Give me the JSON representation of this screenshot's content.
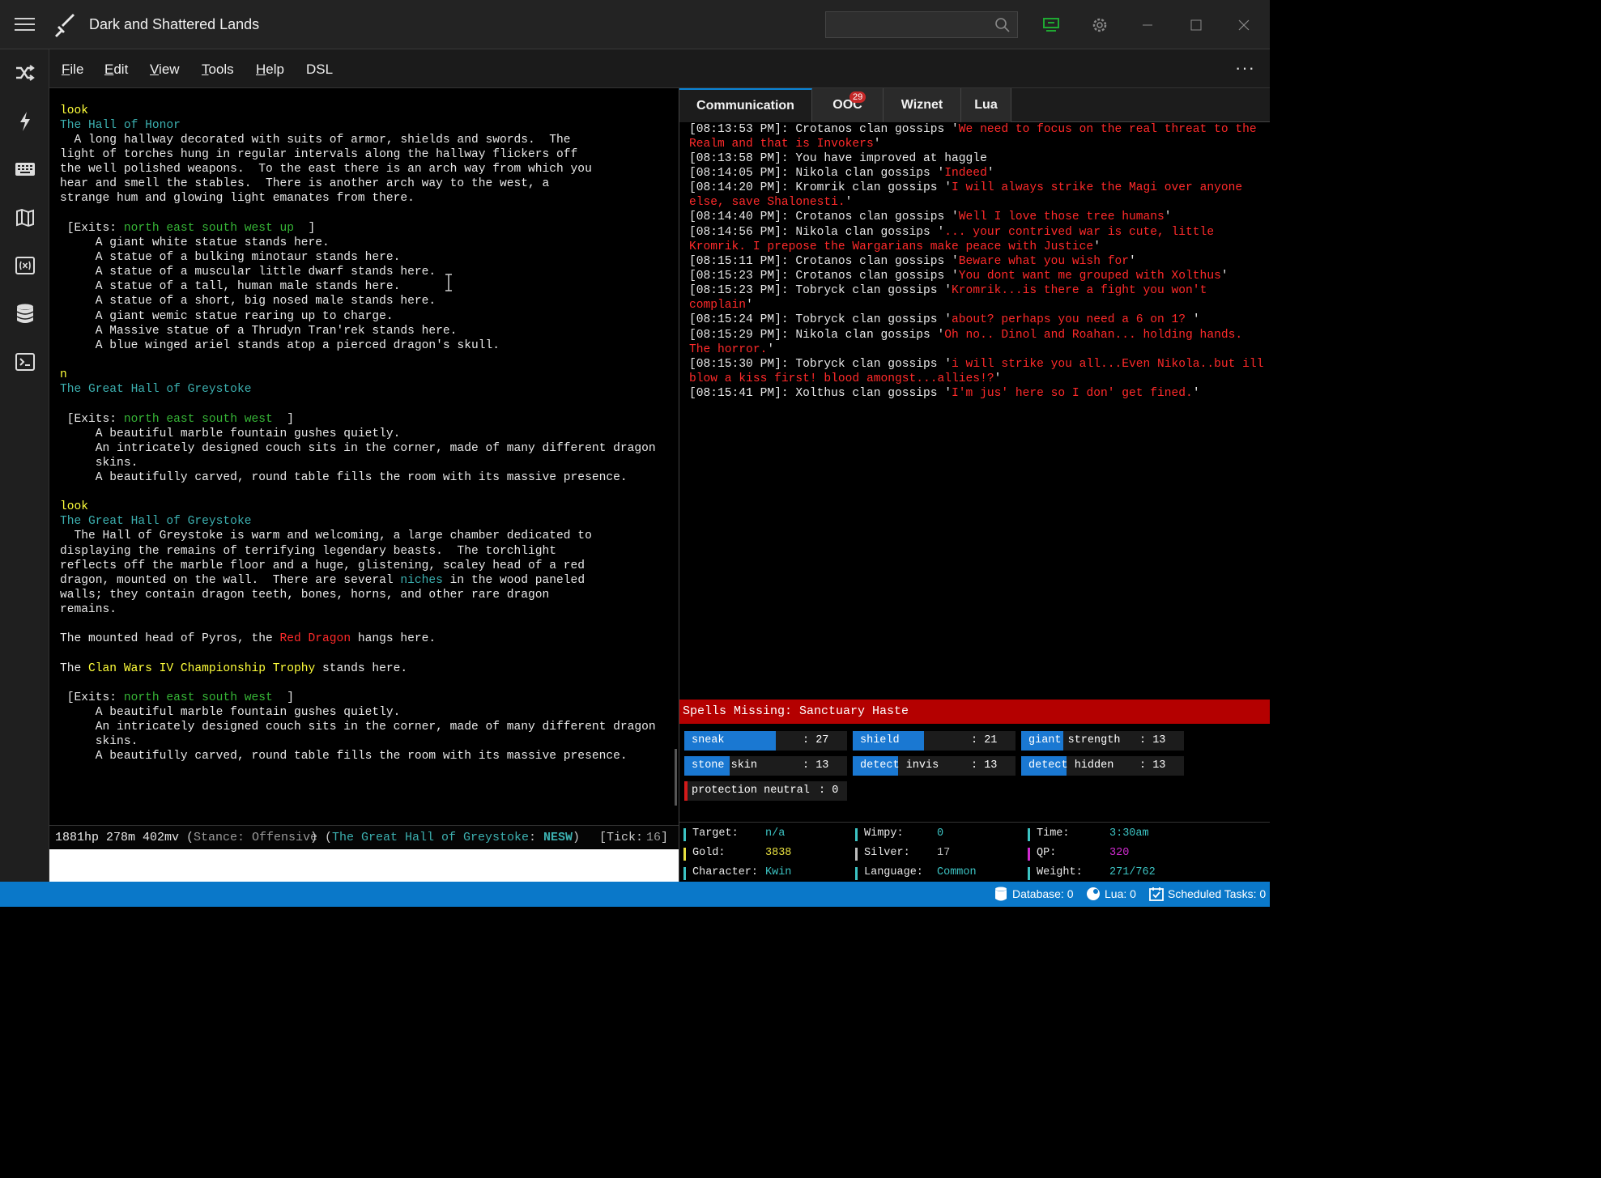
{
  "app": {
    "title": "Dark and Shattered Lands"
  },
  "menu": {
    "file": "F",
    "file_rest": "ile",
    "edit": "E",
    "edit_rest": "dit",
    "view": "V",
    "view_rest": "iew",
    "tools": "T",
    "tools_rest": "ools",
    "help": "H",
    "help_rest": "elp",
    "dsl": "DSL"
  },
  "terminal": {
    "l1": "look",
    "l2": "The Hall of Honor",
    "l3": "  A long hallway decorated with suits of armor, shields and swords.  The",
    "l4": "light of torches hung in regular intervals along the hallway flickers off",
    "l5": "the well polished weapons.  To the east there is an arch way from which you",
    "l6": "hear and smell the stables.  There is another arch way to the west, a",
    "l7": "strange hum and glowing light emanates from there.",
    "l9a": " [Exits: ",
    "l9b": "north east south west up",
    "l9c": "  ]",
    "l10": "     A giant white statue stands here.",
    "l11": "     A statue of a bulking minotaur stands here.",
    "l12": "     A statue of a muscular little dwarf stands here.",
    "l13": "     A statue of a tall, human male stands here.",
    "l14": "     A statue of a short, big nosed male stands here.",
    "l15": "     A giant wemic statue rearing up to charge.",
    "l16": "     A Massive statue of a Thrudyn Tran'rek stands here.",
    "l17": "     A blue winged ariel stands atop a pierced dragon's skull.",
    "l19": "n",
    "l20": "The Great Hall of Greystoke",
    "l22a": " [Exits: ",
    "l22b": "north east south west",
    "l22c": "  ]",
    "l23": "     A beautiful marble fountain gushes quietly.",
    "l24": "     An intricately designed couch sits in the corner, made of many different dragon",
    "l25": "     skins.",
    "l26": "     A beautifully carved, round table fills the room with its massive presence.",
    "l28": "look",
    "l29": "The Great Hall of Greystoke",
    "l30": "  The Hall of Greystoke is warm and welcoming, a large chamber dedicated to",
    "l31": "displaying the remains of terrifying legendary beasts.  The torchlight",
    "l32": "reflects off the marble floor and a huge, glistening, scaley head of a red",
    "l33a": "dragon, mounted on the wall.  There are several ",
    "l33b": "niches",
    "l33c": " in the wood paneled",
    "l34": "walls; they contain dragon teeth, bones, horns, and other rare dragon",
    "l35": "remains.",
    "l37a": "The mounted head of Pyros, the ",
    "l37b": "Red Dragon",
    "l37c": " hangs here.",
    "l39a": "The ",
    "l39b": "Clan Wars IV Championship Trophy",
    "l39c": " stands here.",
    "l41a": " [Exits: ",
    "l41b": "north east south west",
    "l41c": "  ]",
    "l42": "     A beautiful marble fountain gushes quietly.",
    "l43": "     An intricately designed couch sits in the corner, made of many different dragon",
    "l44": "     skins.",
    "l45": "     A beautifully carved, round table fills the room with its massive presence."
  },
  "prompt": {
    "hp": "1881hp 278m 402mv",
    "stance_open": " (",
    "stance_lbl": "Stance:",
    "stance_val": "Offensive",
    "stance_close": ")",
    "room_open": " (",
    "room": "The Great Hall of Greystoke",
    "colon": ":",
    "dirs": " NESW",
    "room_close": ")",
    "tick_open": "[",
    "tick_lbl": "Tick:",
    "tick_val": "16",
    "tick_close": "]"
  },
  "tabs": {
    "communication": "Communication",
    "ooc": "OOC",
    "ooc_badge": "29",
    "wiznet": "Wiznet",
    "lua": "Lua"
  },
  "comm": [
    {
      "p": "[08:13:53 PM]: Crotanos clan gossips '",
      "q": "We need to focus on the real threat to the"
    },
    {
      "p": "",
      "q": "Realm and that is Invokers",
      "s": "'"
    },
    {
      "p": "[08:13:58 PM]: You have improved at haggle",
      "q": ""
    },
    {
      "p": "[08:14:05 PM]: Nikola clan gossips '",
      "q": "Indeed",
      "s": "'"
    },
    {
      "p": "[08:14:20 PM]: Kromrik clan gossips '",
      "q": "I will always strike the Magi over anyone"
    },
    {
      "p": "",
      "q": "else, save Shalonesti.",
      "s": "'"
    },
    {
      "p": "[08:14:40 PM]: Crotanos clan gossips '",
      "q": "Well I love those tree humans",
      "s": "'"
    },
    {
      "p": "[08:14:56 PM]: Nikola clan gossips '",
      "q": "... your contrived war is cute, little"
    },
    {
      "p": "",
      "q": "Kromrik. I prepose the Wargarians make peace with Justice",
      "s": "'"
    },
    {
      "p": "[08:15:11 PM]: Crotanos clan gossips '",
      "q": "Beware what you wish for",
      "s": "'"
    },
    {
      "p": "[08:15:23 PM]: Crotanos clan gossips '",
      "q": "You dont want me grouped with Xolthus",
      "s": "'"
    },
    {
      "p": "[08:15:23 PM]: Tobryck clan gossips '",
      "q": "Kromrik...is there a fight you won't"
    },
    {
      "p": "",
      "q": "complain",
      "s": "'"
    },
    {
      "p": "[08:15:24 PM]: Tobryck clan gossips '",
      "q": "about? perhaps you need a 6 on 1? ",
      "s": "'"
    },
    {
      "p": "[08:15:29 PM]: Nikola clan gossips '",
      "q": "Oh no.. Dinol and Roahan... holding hands."
    },
    {
      "p": "",
      "q": "The horror.",
      "s": "'"
    },
    {
      "p": "[08:15:30 PM]: Tobryck clan gossips '",
      "q": "i will strike you all...Even Nikola..but ill"
    },
    {
      "p": "",
      "q": "blow a kiss first! blood amongst...allies!?",
      "s": "'"
    },
    {
      "p": "[08:15:41 PM]: Xolthus clan gossips '",
      "q": "I'm jus' here so I don' get fined.",
      "s": "'"
    }
  ],
  "spells_missing": "Spells Missing: Sanctuary Haste",
  "affects": [
    {
      "name": "sneak",
      "value": ": 27",
      "fill": 0.56
    },
    {
      "name": "shield",
      "value": ": 21",
      "fill": 0.44
    },
    {
      "name": "giant strength",
      "value": ": 13",
      "fill": 0.26
    },
    {
      "name": "stone skin",
      "value": ": 13",
      "fill": 0.28
    },
    {
      "name": "detect invis",
      "value": ": 13",
      "fill": 0.28
    },
    {
      "name": "detect hidden",
      "value": ": 13",
      "fill": 0.28
    },
    {
      "name": "protection neutral",
      "value": ": 0",
      "fill": 0.02
    }
  ],
  "stats": {
    "target_lbl": "Target:",
    "target": "n/a",
    "wimpy_lbl": "Wimpy:",
    "wimpy": "0",
    "time_lbl": "Time:",
    "time": "3:30am",
    "gold_lbl": "Gold:",
    "gold": "3838",
    "silver_lbl": "Silver:",
    "silver": "17",
    "qp_lbl": "QP:",
    "qp": "320",
    "char_lbl": "Character:",
    "char": "Kwin",
    "lang_lbl": "Language:",
    "lang": "Common",
    "weight_lbl": "Weight:",
    "weight": "271/762"
  },
  "statusbar": {
    "database": "Database: 0",
    "lua": "Lua: 0",
    "tasks": "Scheduled Tasks: 0"
  },
  "colors": {
    "accent": "#0a78c9",
    "exit": "#36b536",
    "room": "#3cb0b0",
    "command": "#ffff3a",
    "gossip": "#ff2a2a"
  }
}
